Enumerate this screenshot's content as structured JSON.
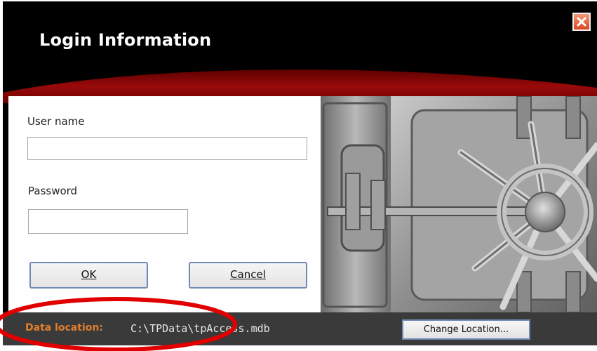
{
  "window": {
    "title": "Login Information",
    "close_icon": "close-icon"
  },
  "form": {
    "username_label": "User name",
    "username_value": "",
    "password_label": "Password",
    "password_value": "",
    "ok_label": "OK",
    "cancel_label": "Cancel"
  },
  "image": {
    "icon": "vault-door-icon"
  },
  "footer": {
    "data_location_label": "Data location:",
    "data_location_value": "C:\\TPData\\tpAccess.mdb",
    "change_location_label": "Change Location..."
  },
  "colors": {
    "title_bg": "#000000",
    "accent_red": "#8e0000",
    "footer_bg": "#3a3a3a",
    "footer_label": "#e07e2d",
    "annotation_red": "#e00000"
  }
}
